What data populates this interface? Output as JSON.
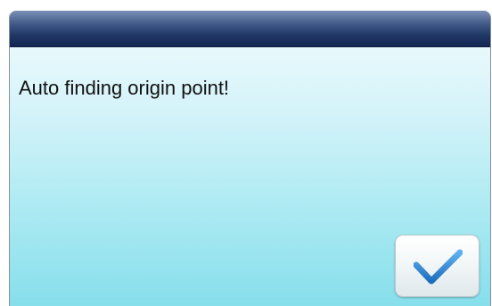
{
  "dialog": {
    "message": "Auto finding origin point!",
    "confirm_icon": "checkmark-icon",
    "accent_color": "#2f86d6"
  }
}
